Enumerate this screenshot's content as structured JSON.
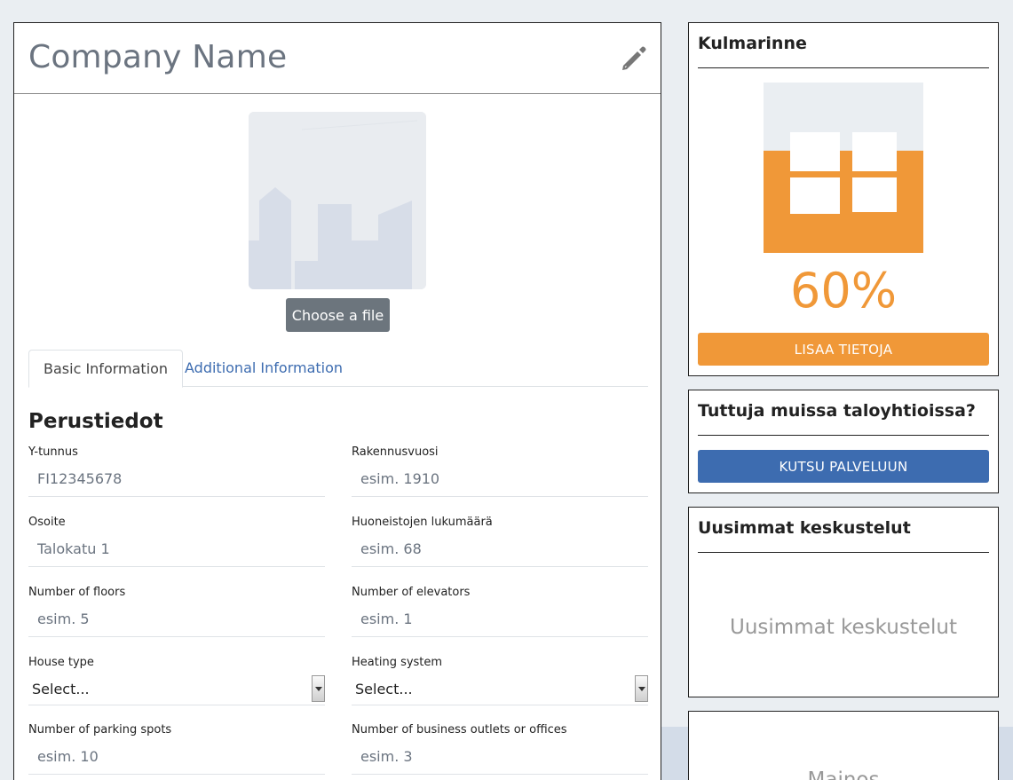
{
  "company": {
    "name": "Company Name",
    "edit_icon": "pencil-icon",
    "choose_file_label": "Choose a file"
  },
  "tabs": [
    {
      "label": "Basic Information",
      "active": true
    },
    {
      "label": "Additional Information",
      "active": false
    }
  ],
  "form": {
    "section_title": "Perustiedot",
    "fields": {
      "y_tunnus": {
        "label": "Y-tunnus",
        "placeholder": "FI12345678"
      },
      "rakennusvuosi": {
        "label": "Rakennusvuosi",
        "placeholder": "esim. 1910"
      },
      "osoite": {
        "label": "Osoite",
        "placeholder": "Talokatu 1"
      },
      "huoneistot": {
        "label": "Huoneistojen lukumäärä",
        "placeholder": "esim. 68"
      },
      "floors": {
        "label": "Number of floors",
        "placeholder": "esim. 5"
      },
      "elevators": {
        "label": "Number of elevators",
        "placeholder": "esim. 1"
      },
      "house_type": {
        "label": "House type",
        "value": "Select..."
      },
      "heating": {
        "label": "Heating system",
        "value": "Select..."
      },
      "parking": {
        "label": "Number of parking spots",
        "placeholder": "esim. 10"
      },
      "business": {
        "label": "Number of business outlets or offices",
        "placeholder": "esim. 3"
      }
    }
  },
  "sidebar": {
    "kulmarinne": {
      "title": "Kulmarinne",
      "completion_percent": "60%",
      "completion_fraction": 0.6,
      "button_label": "LISAA TIETOJA",
      "accent_color": "#f09838"
    },
    "invite": {
      "title": "Tuttuja muissa taloyhtioissa?",
      "button_label": "KUTSU PALVELUUN",
      "button_color": "#3d6cb0"
    },
    "discussions": {
      "title": "Uusimmat keskustelut",
      "placeholder": "Uusimmat keskustelut"
    },
    "ad": {
      "placeholder": "Mainos"
    }
  }
}
